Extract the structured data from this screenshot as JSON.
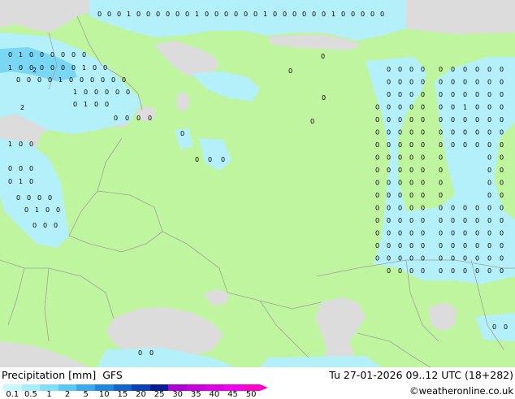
{
  "map": {
    "colors": {
      "land": "#bff59f",
      "sea": "#dcdcdc",
      "border": "#a0a0a0",
      "precip_light": "#b4f0fa",
      "precip_medium": "#7ad7f3"
    },
    "cell_marker_labels": [
      "0",
      "1",
      "2"
    ]
  },
  "footer": {
    "title_left": "Precipitation [mm]",
    "model": "GFS",
    "datetime": "Tu 27-01-2026 09..12 UTC (18+282)",
    "credit": "©weatheronline.co.uk"
  },
  "legend": {
    "labels": [
      "0.1",
      "0.5",
      "1",
      "2",
      "5",
      "10",
      "15",
      "20",
      "25",
      "30",
      "35",
      "40",
      "45",
      "50"
    ],
    "colors": [
      "#c8f8fc",
      "#a6eefa",
      "#80e0f8",
      "#5ac8f2",
      "#3aa8ec",
      "#1e88e0",
      "#1464d0",
      "#0c40b8",
      "#061c98",
      "#b000d8",
      "#c800e0",
      "#dc00e8",
      "#f000f0",
      "#ff00c8"
    ]
  }
}
